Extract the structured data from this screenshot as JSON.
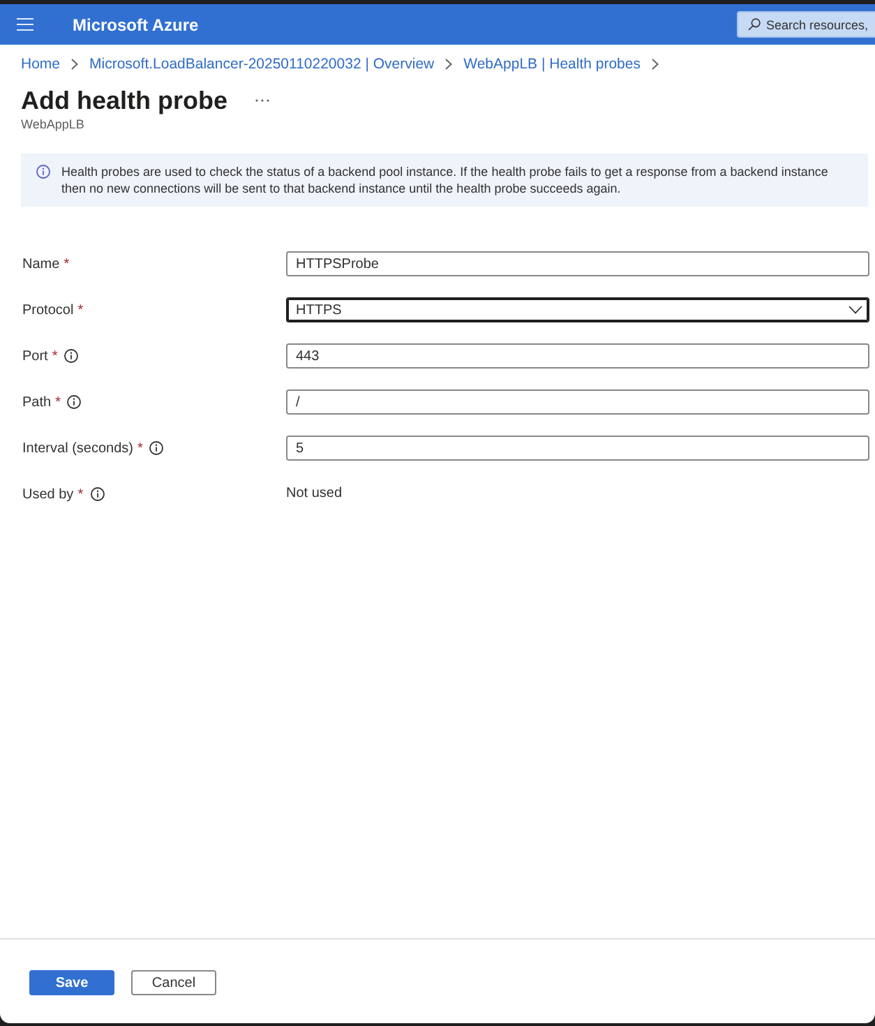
{
  "header": {
    "title": "Microsoft Azure",
    "search": {
      "placeholder": "Search resources,"
    }
  },
  "breadcrumb": [
    {
      "label": "Home"
    },
    {
      "label": "Microsoft.LoadBalancer-20250110220032 | Overview"
    },
    {
      "label": "WebAppLB | Health probes"
    }
  ],
  "page": {
    "title": "Add health probe",
    "subtitle": "WebAppLB"
  },
  "info_banner": {
    "text": "Health probes are used to check the status of a backend pool instance. If the health probe fails to get a response from a backend instance then no new connections will be sent to that backend instance until the health probe succeeds again."
  },
  "fields": [
    {
      "kind": "text",
      "label": "Name",
      "required_mark": "*",
      "info": false,
      "value": "HTTPSProbe",
      "focused": false
    },
    {
      "kind": "dropdown",
      "label": "Protocol",
      "required_mark": "*",
      "info": false,
      "value": "HTTPS",
      "focused": true
    },
    {
      "kind": "text",
      "label": "Port",
      "required_mark": "*",
      "info": true,
      "value": "443",
      "focused": false
    },
    {
      "kind": "text",
      "label": "Path",
      "required_mark": "*",
      "info": true,
      "value": "/",
      "focused": false
    },
    {
      "kind": "text",
      "label": "Interval (seconds)",
      "required_mark": "*",
      "info": true,
      "value": "5",
      "focused": false
    },
    {
      "kind": "static",
      "label": "Used by",
      "required_mark": "*",
      "info": true,
      "value": "Not used"
    }
  ],
  "buttons": [
    {
      "kind": "primary",
      "label": "Save"
    },
    {
      "kind": "secondary",
      "label": "Cancel"
    }
  ]
}
